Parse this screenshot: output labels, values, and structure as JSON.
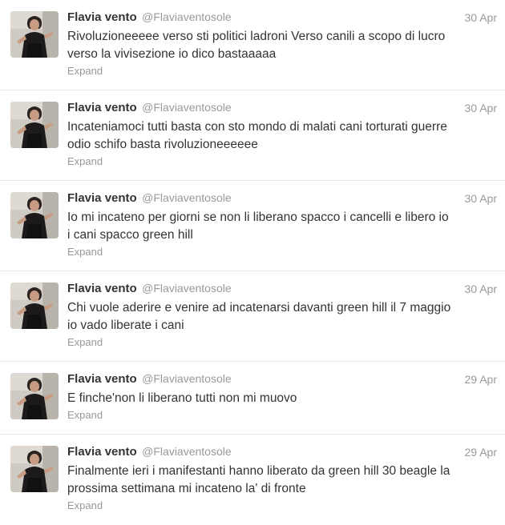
{
  "tweets": [
    {
      "name": "Flavia vento",
      "handle": "@Flaviaventosole",
      "date": "30 Apr",
      "line1": "Rivoluzioneeeee verso sti politici ladroni Verso canili a scopo di lucro",
      "line2": "verso la vivisezione io dico bastaaaaa",
      "expand": "Expand"
    },
    {
      "name": "Flavia vento",
      "handle": "@Flaviaventosole",
      "date": "30 Apr",
      "line1": "Incateniamoci tutti basta con sto mondo di malati cani torturati guerre",
      "line2": "odio schifo basta rivoluzioneeeeee",
      "expand": "Expand"
    },
    {
      "name": "Flavia vento",
      "handle": "@Flaviaventosole",
      "date": "30 Apr",
      "line1": "Io mi incateno per giorni se non li liberano spacco i cancelli e libero io",
      "line2": "i cani spacco green hill",
      "expand": "Expand"
    },
    {
      "name": "Flavia vento",
      "handle": "@Flaviaventosole",
      "date": "30 Apr",
      "line1": "Chi vuole aderire e venire ad incatenarsi davanti green hill il 7 maggio",
      "line2": "io vado liberate i cani",
      "expand": "Expand"
    },
    {
      "name": "Flavia vento",
      "handle": "@Flaviaventosole",
      "date": "29 Apr",
      "line1": "E finche'non li liberano tutti non mi muovo",
      "expand": "Expand"
    },
    {
      "name": "Flavia vento",
      "handle": "@Flaviaventosole",
      "date": "29 Apr",
      "line1": "Finalmente ieri i manifestanti hanno liberato da green hill 30 beagle la",
      "line2": "prossima settimana mi incateno la' di fronte",
      "expand": "Expand"
    }
  ]
}
